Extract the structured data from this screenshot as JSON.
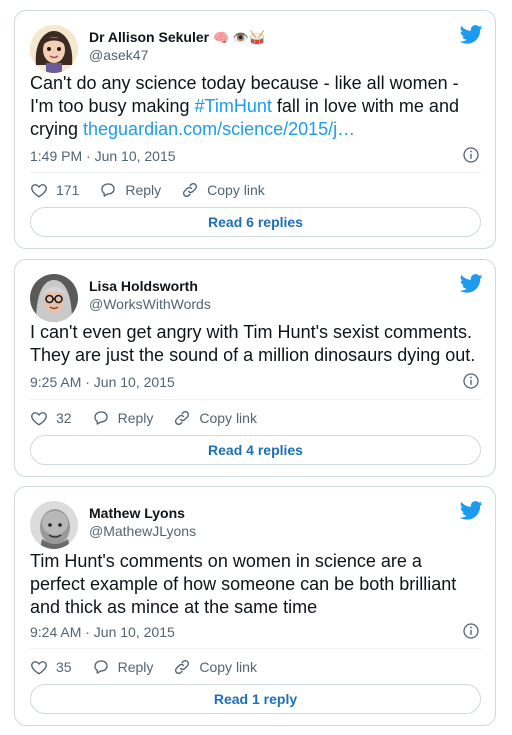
{
  "tweets": [
    {
      "name": "Dr Allison Sekuler",
      "name_emoji": "🧠 👁️🥁",
      "handle": "@asek47",
      "text_before": "Can't do any science today because - like all women - I'm too busy making ",
      "hashtag": "#TimHunt",
      "text_after": " fall in love with me and crying ",
      "link": "theguardian.com/science/2015/j…",
      "timestamp": "1:49 PM · Jun 10, 2015",
      "likes": "171",
      "reply_label": "Reply",
      "copy_label": "Copy link",
      "read_replies": "Read 6 replies"
    },
    {
      "name": "Lisa Holdsworth",
      "handle": "@WorksWithWords",
      "text": "I can't even get angry with Tim Hunt's sexist comments. They are just the sound of a million dinosaurs dying out.",
      "timestamp": "9:25 AM · Jun 10, 2015",
      "likes": "32",
      "reply_label": "Reply",
      "copy_label": "Copy link",
      "read_replies": "Read 4 replies"
    },
    {
      "name": "Mathew Lyons",
      "handle": "@MathewJLyons",
      "text": "Tim Hunt's comments on women in science are a perfect example of how someone can be both brilliant and thick as mince at the same time",
      "timestamp": "9:24 AM · Jun 10, 2015",
      "likes": "35",
      "reply_label": "Reply",
      "copy_label": "Copy link",
      "read_replies": "Read 1 reply"
    }
  ],
  "colors": {
    "accent": "#1d9bf0",
    "button_text": "#1d70b8",
    "muted": "#536471",
    "border": "#cfd9de"
  },
  "icons": [
    "twitter-bird-icon",
    "info-icon",
    "heart-icon",
    "reply-bubble-icon",
    "copy-link-icon"
  ]
}
